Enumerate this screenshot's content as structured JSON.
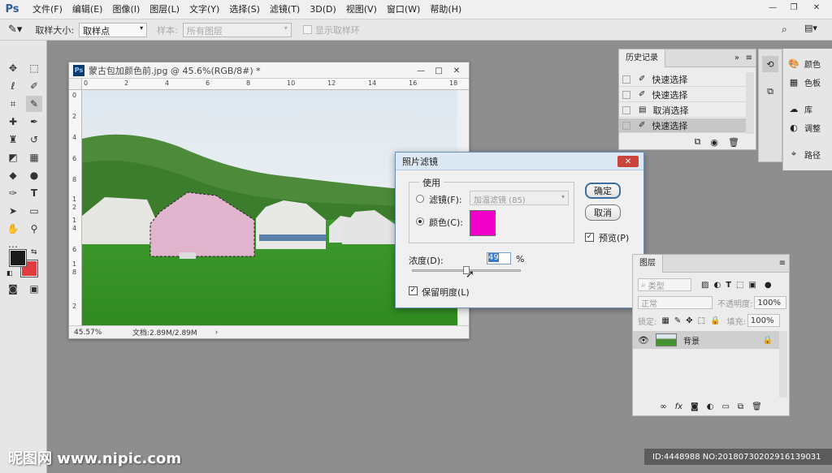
{
  "app": {
    "logo": "Ps"
  },
  "menu": [
    "文件(F)",
    "编辑(E)",
    "图像(I)",
    "图层(L)",
    "文字(Y)",
    "选择(S)",
    "滤镜(T)",
    "3D(D)",
    "视图(V)",
    "窗口(W)",
    "帮助(H)"
  ],
  "options": {
    "sample_size_label": "取样大小:",
    "sample_size_value": "取样点",
    "sample_label": "样本:",
    "sample_value": "所有图层",
    "show_ring_label": "显示取样环"
  },
  "document": {
    "title": "蒙古包加颜色前.jpg @ 45.6%(RGB/8#) *",
    "zoom": "45.57%",
    "doc_size": "文档:2.89M/2.89M",
    "ruler_h": [
      "0",
      "2",
      "4",
      "6",
      "8",
      "10",
      "12",
      "14",
      "16",
      "18"
    ],
    "ruler_v": [
      "0",
      "2",
      "4",
      "6",
      "8",
      "1",
      "2",
      "1",
      "4",
      "6",
      "1",
      "8",
      "2"
    ]
  },
  "dialog": {
    "title": "照片滤镜",
    "use_label": "使用",
    "filter_label": "滤镜(F):",
    "filter_value": "加温滤镜 (85)",
    "color_label": "颜色(C):",
    "color_swatch": "#f000c8",
    "density_label": "浓度(D):",
    "density_value": "49",
    "density_unit": "%",
    "density_fraction": 0.49,
    "preserve_label": "保留明度(L)",
    "ok_label": "确定",
    "cancel_label": "取消",
    "preview_label": "预览(P)"
  },
  "history": {
    "tab": "历史记录",
    "items": [
      "快速选择",
      "快速选择",
      "取消选择",
      "快速选择"
    ]
  },
  "right_panel": {
    "items": [
      "颜色",
      "色板",
      "库",
      "调整",
      "路径"
    ]
  },
  "layers": {
    "tab": "图层",
    "kind_label": "类型",
    "blend_mode": "正常",
    "opacity_label": "不透明度:",
    "opacity_value": "100%",
    "lock_label": "锁定:",
    "fill_label": "填充:",
    "fill_value": "100%",
    "layer_name": "背景"
  },
  "watermark": {
    "site": "昵图网 www.nipic.com",
    "id": "ID:4448988 NO:20180730202916139031"
  },
  "colors": {
    "foreground": "#1a1a1a",
    "background": "#e23b40",
    "accent": "#f000c8"
  }
}
